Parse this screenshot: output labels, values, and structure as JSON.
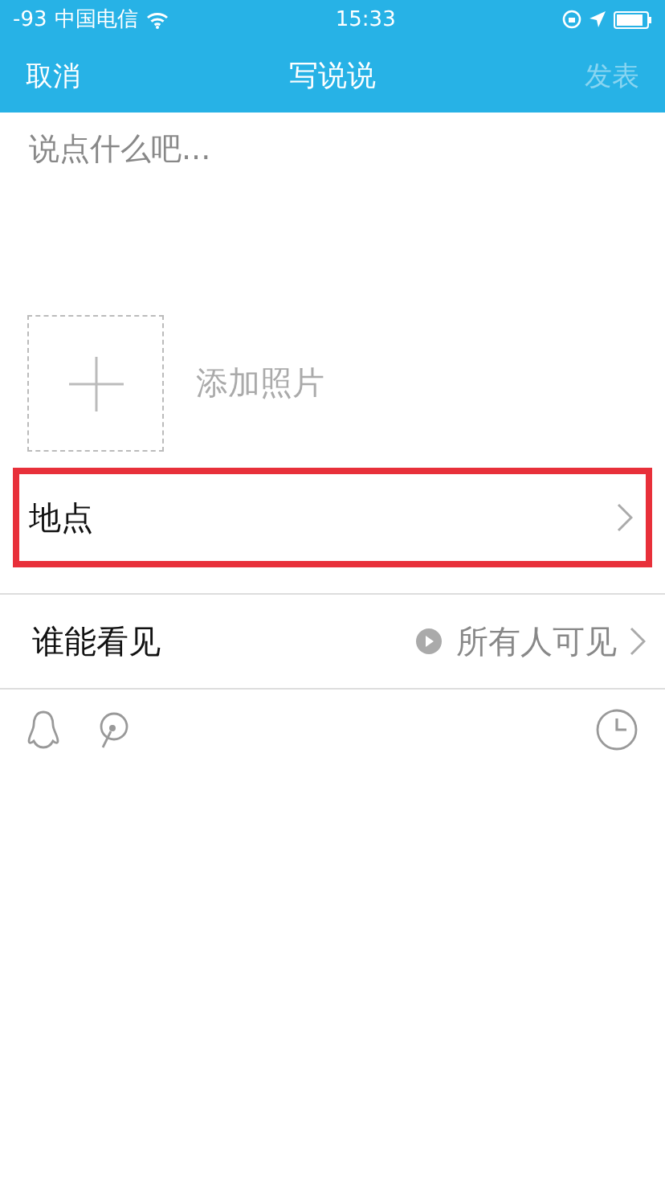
{
  "status_bar": {
    "signal": "-93",
    "carrier": "中国电信",
    "time": "15:33"
  },
  "nav": {
    "cancel": "取消",
    "title": "写说说",
    "publish": {
      "label": "发表",
      "disabled": true
    }
  },
  "compose": {
    "placeholder": "说点什么吧..."
  },
  "photo": {
    "label": "添加照片"
  },
  "rows": [
    {
      "kind": "location",
      "label": "地点",
      "highlighted": true
    },
    {
      "kind": "visibility",
      "label": "谁能看见",
      "value": "所有人可见",
      "highlighted": false
    }
  ]
}
